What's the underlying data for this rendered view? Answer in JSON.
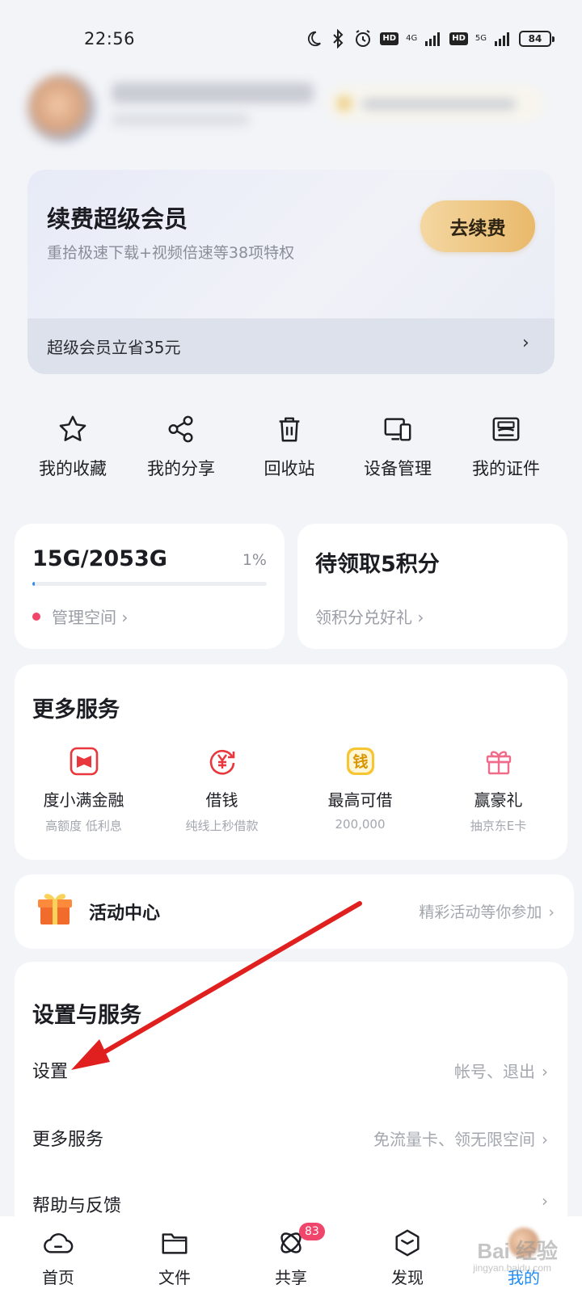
{
  "status_bar": {
    "time": "22:56",
    "net_4g": "4G",
    "net_5g": "5G",
    "hd": "HD",
    "battery": "84"
  },
  "vip": {
    "title": "续费超级会员",
    "subtitle": "重拾极速下载+视频倍速等38项特权",
    "button": "去续费",
    "footer": "超级会员立省35元",
    "footer_arrow": "›"
  },
  "quick_actions": [
    {
      "label": "我的收藏",
      "icon": "star-icon"
    },
    {
      "label": "我的分享",
      "icon": "share-icon"
    },
    {
      "label": "回收站",
      "icon": "trash-icon"
    },
    {
      "label": "设备管理",
      "icon": "devices-icon"
    },
    {
      "label": "我的证件",
      "icon": "id-card-icon"
    }
  ],
  "storage": {
    "used": "15G/2053G",
    "percent": "1%",
    "fill_fraction": 0.01,
    "link": "管理空间 ›"
  },
  "points": {
    "title": "待领取5积分",
    "link": "领积分兑好礼 ›"
  },
  "more_services": {
    "title": "更多服务",
    "items": [
      {
        "name": "度小满金融",
        "desc": "高额度 低利息",
        "icon": "duxiaoman-icon",
        "color": "#e8383d"
      },
      {
        "name": "借钱",
        "desc": "纯线上秒借款",
        "icon": "yen-circle-icon",
        "color": "#e8383d"
      },
      {
        "name": "最高可借",
        "desc": "200,000",
        "icon": "money-icon",
        "color": "#f2b21c"
      },
      {
        "name": "赢豪礼",
        "desc": "抽京东E卡",
        "icon": "gift-icon",
        "color": "#f06a8a"
      }
    ]
  },
  "activity": {
    "title": "活动中心",
    "hint": "精彩活动等你参加",
    "chevron": "›"
  },
  "settings": {
    "title": "设置与服务",
    "rows": [
      {
        "label": "设置",
        "hint": "帐号、退出"
      },
      {
        "label": "更多服务",
        "hint": "免流量卡、领无限空间"
      },
      {
        "label": "帮助与反馈",
        "hint": ""
      }
    ],
    "chevron": "›"
  },
  "bottom_nav": {
    "items": [
      {
        "label": "首页",
        "icon": "home-cloud-icon"
      },
      {
        "label": "文件",
        "icon": "folder-icon"
      },
      {
        "label": "共享",
        "icon": "share-orbit-icon",
        "badge": "83"
      },
      {
        "label": "发现",
        "icon": "cube-icon"
      },
      {
        "label": "我的",
        "icon": "profile-icon",
        "active": true
      }
    ]
  },
  "watermark": {
    "text": "Bai 经验",
    "sub": "jingyan.baidu.com"
  },
  "colors": {
    "accent": "#1e8cf5",
    "vip_gold": "#e9b96b",
    "annotation_arrow": "#e01f1f",
    "badge": "#f0466b"
  }
}
